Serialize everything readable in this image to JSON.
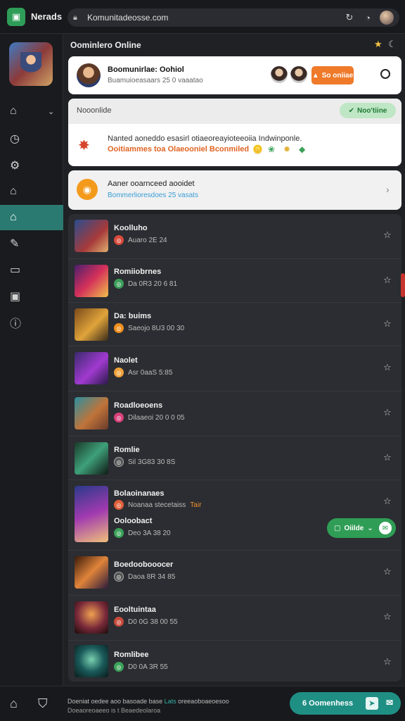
{
  "app": {
    "name": "Nerads",
    "logo_glyph": "▣"
  },
  "browser": {
    "url": "Komunitadeosse.com",
    "icons": [
      "lock-icon",
      "refresh-icon",
      "clock-icon",
      "profile-icon"
    ]
  },
  "sidebar": {
    "items": [
      {
        "name": "home",
        "glyph": "⌂"
      },
      {
        "name": "timer",
        "glyph": "◷"
      },
      {
        "name": "settings",
        "glyph": "⚙"
      },
      {
        "name": "house",
        "glyph": "⌂"
      },
      {
        "name": "store",
        "glyph": "⌂"
      },
      {
        "name": "edit",
        "glyph": "✎"
      },
      {
        "name": "folder",
        "glyph": "▭"
      },
      {
        "name": "gallery",
        "glyph": "▣"
      },
      {
        "name": "help",
        "glyph": "?"
      }
    ]
  },
  "main": {
    "section_title": "Oominlero Online",
    "status": {
      "name": "Boomunirlae: Oohiol",
      "sub": "Buamuioeasaars 25 0 vaaatao",
      "online_label": "So oniiae"
    },
    "notification": {
      "header_label": "Nooonlide",
      "badge_label": "Noo'tiine",
      "line1": "Nanted aoneddo esasirl otiaeoreayioteeoiia Indwinponle.",
      "line2": "Ooitiammes toa Olaeooniel Bconmiled"
    },
    "message": {
      "title": "Aaner ooarnceed aooidet",
      "sub": "Bommerlioresdoes 25 vasats"
    },
    "games": [
      {
        "title": "Koolluho",
        "meta": "Auaro 2E 24",
        "dot_color": "#d94a3d"
      },
      {
        "title": "Romiiobrnes",
        "meta": "Da 0R3 20 6 81",
        "dot_color": "#3c9e5b"
      },
      {
        "title": "Da: buims",
        "meta": "Saeojo 8U3 00 30",
        "dot_color": "#ef8f1d"
      },
      {
        "title": "Naolet",
        "meta": "Asr 0aaS 5:85",
        "dot_color": "#f0a23a"
      },
      {
        "title": "Roadloeoens",
        "meta": "Dilaaeoi 20 0 0 05",
        "dot_color": "#d8407a"
      },
      {
        "title": "Romlie",
        "meta": "Sil 3G83 30 8S",
        "dot_color": "#555555"
      },
      {
        "title": "Bolaoinanaes",
        "meta": "Noanaa stecetaiss",
        "hot": "Tair",
        "sub_title": "Ooloobact",
        "sub_meta": "Deo 3A 38 20",
        "dot_color": "#e0603a",
        "sub_dot_color": "#3ca25a"
      },
      {
        "title": "Boedoobooocer",
        "meta": "Daoa 8R 34 85",
        "dot_color": "#555555"
      },
      {
        "title": "Eooltuintaa",
        "meta": "D0 0G 38 00 55",
        "dot_color": "#c74b3c"
      },
      {
        "title": "Romlibee",
        "meta": "D0 0A 3R 55",
        "dot_color": "#3ca25a"
      }
    ],
    "online_pill": "Oiilde"
  },
  "bottom": {
    "line1_a": "Doeniat oedee aoo basoade base",
    "line1_hl": "Lats",
    "line1_b": "oreeaoboaeoesoo",
    "line2": "Doeaoreoaeeo is t Beaedeolaroa",
    "cta_label": "6 Oomenhess"
  },
  "colors": {
    "accent": "#2b7a72",
    "orange": "#ee7a2a",
    "green": "#2f9d55"
  }
}
